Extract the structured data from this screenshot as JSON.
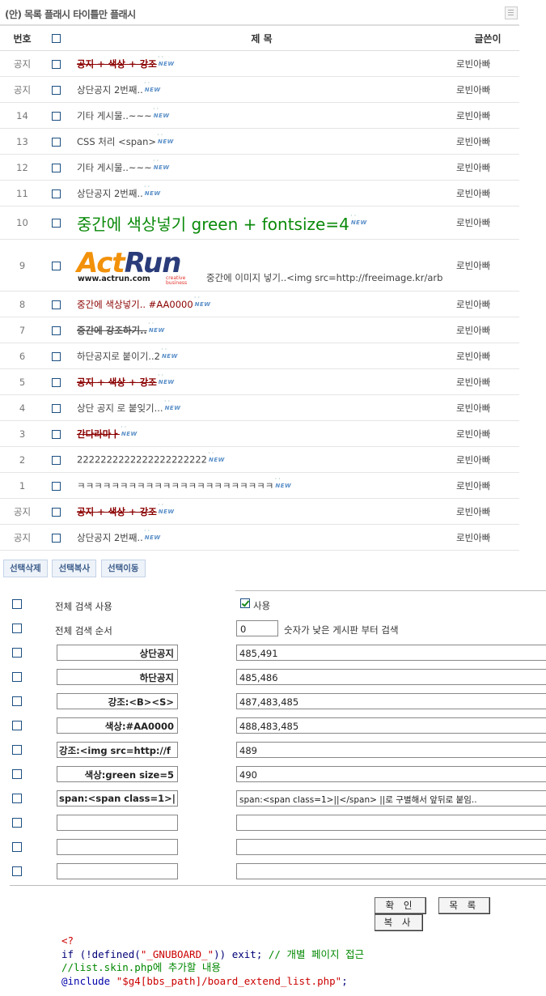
{
  "header": {
    "title": "(안) 목록 플래시 타이틀만 플래시",
    "rss_icon": "rss-list-icon"
  },
  "table": {
    "columns": {
      "num": "번호",
      "subject": "제 목",
      "writer": "글쓴이"
    },
    "new_label": "NEW",
    "rows": [
      {
        "num": "공지",
        "subject": "공지 + 색상 + 강조",
        "style": "strike",
        "writer": "로빈아빠"
      },
      {
        "num": "공지",
        "subject": "상단공지 2번째..",
        "style": "normal",
        "writer": "로빈아빠"
      },
      {
        "num": "14",
        "subject": "기타 게시물..~~~",
        "style": "normal",
        "writer": "로빈아빠"
      },
      {
        "num": "13",
        "subject": "CSS 처리 <span>",
        "style": "normal",
        "writer": "로빈아빠"
      },
      {
        "num": "12",
        "subject": "기타 게시물..~~~",
        "style": "normal",
        "writer": "로빈아빠"
      },
      {
        "num": "11",
        "subject": "상단공지 2번째..",
        "style": "normal",
        "writer": "로빈아빠"
      },
      {
        "num": "10",
        "subject": "중간에 색상넣기 green + fontsize=4",
        "style": "green-big",
        "writer": "로빈아빠"
      },
      {
        "num": "9",
        "subject": "중간에 이미지 넣기..<img src=http://freeimage.kr/arb",
        "style": "image",
        "writer": "로빈아빠",
        "logo": {
          "part1": "Act",
          "part2": "Run",
          "url": "www.actrun.com",
          "tag1": "creative",
          "tag2": "business"
        }
      },
      {
        "num": "8",
        "subject": "중간에 색상넣기.. #AA0000",
        "style": "red",
        "writer": "로빈아빠"
      },
      {
        "num": "7",
        "subject": "중간에 강조하기..",
        "style": "strike-dark",
        "writer": "로빈아빠"
      },
      {
        "num": "6",
        "subject": "하단공지로 붙이기..2",
        "style": "normal",
        "writer": "로빈아빠"
      },
      {
        "num": "5",
        "subject": "공지 + 색상 + 강조",
        "style": "strike",
        "writer": "로빈아빠"
      },
      {
        "num": "4",
        "subject": "상단 공지 로 붙잊기...",
        "style": "normal",
        "writer": "로빈아빠"
      },
      {
        "num": "3",
        "subject": "간다라마ㅏ",
        "style": "strike",
        "writer": "로빈아빠"
      },
      {
        "num": "2",
        "subject": "2222222222222222222222",
        "style": "normal",
        "writer": "로빈아빠"
      },
      {
        "num": "1",
        "subject": "ㅋㅋㅋㅋㅋㅋㅋㅋㅋㅋㅋㅋㅋㅋㅋㅋㅋㅋㅋㅋㅋㅋㅋ",
        "style": "normal",
        "writer": "로빈아빠"
      },
      {
        "num": "공지",
        "subject": "공지 + 색상 + 강조",
        "style": "strike",
        "writer": "로빈아빠"
      },
      {
        "num": "공지",
        "subject": "상단공지 2번째..",
        "style": "normal",
        "writer": "로빈아빠"
      }
    ]
  },
  "buttons": {
    "delete": "선택삭제",
    "copy": "선택복사",
    "move": "선택이동"
  },
  "form": {
    "search_use_label": "전체 검색 사용",
    "search_use_value": "사용",
    "search_order_label": "전체 검색 순서",
    "search_order_value": "0",
    "search_order_hint": "숫자가 낮은 게시판 부터 검색",
    "rows": [
      {
        "left": "상단공지",
        "right": "485,491"
      },
      {
        "left": "하단공지",
        "right": "485,486"
      },
      {
        "left": "강조:<B><S>",
        "right": "487,483,485"
      },
      {
        "left": "색상:#AA0000",
        "right": "488,483,485"
      },
      {
        "left": "강조:<img src=http://f",
        "right": "489"
      },
      {
        "left": "색상:green size=5",
        "right": "490"
      },
      {
        "left": "span:<span  class=1>|",
        "right": "span:<span  class=1>||</span>  ||로 구별해서 앞뒤로 붙임.."
      },
      {
        "left": "",
        "right": ""
      },
      {
        "left": "",
        "right": ""
      },
      {
        "left": "",
        "right": ""
      }
    ],
    "confirm": "확 인",
    "list": "목 록",
    "copy": "복 사"
  },
  "code": {
    "line1": "<?",
    "line2_a": "if (!defined(",
    "line2_b": "\"_GNUBOARD_\"",
    "line2_c": ")) exit; ",
    "line2_d": "// 개별 페이지 접근",
    "line3": "//list.skin.php에 추가할 내용",
    "line4_a": "@include ",
    "line4_b": "\"$g4[bbs_path]/board_extend_list.php\"",
    "line4_c": ";"
  }
}
